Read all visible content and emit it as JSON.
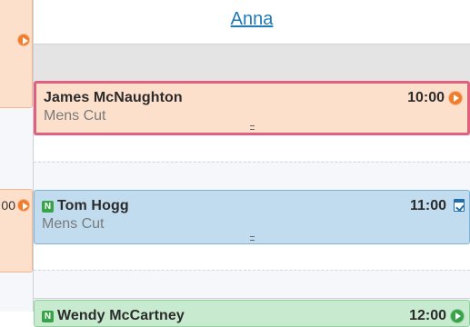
{
  "header": {
    "staff_name": "Anna"
  },
  "left_column": {
    "edge_time_label": "00"
  },
  "appointments": [
    {
      "client": "James McNaughton",
      "service": "Mens Cut",
      "time": "10:00",
      "status_icon": "play-icon",
      "color": "#fde0cc",
      "border_color": "#e0607f",
      "selected": true
    },
    {
      "badge": "N",
      "client": "Tom Hogg",
      "service": "Mens Cut",
      "time": "11:00",
      "status_icon": "calendar-check-icon",
      "color": "#c0dcee"
    },
    {
      "badge": "N",
      "client": "Wendy McCartney",
      "time": "12:00",
      "color": "#c8ebcf"
    }
  ],
  "colors": {
    "accent_link": "#1f7ab8",
    "selected_outline": "#e0607f",
    "new_client_badge": "#3aa34a",
    "play_icon": "#f07c2c"
  }
}
